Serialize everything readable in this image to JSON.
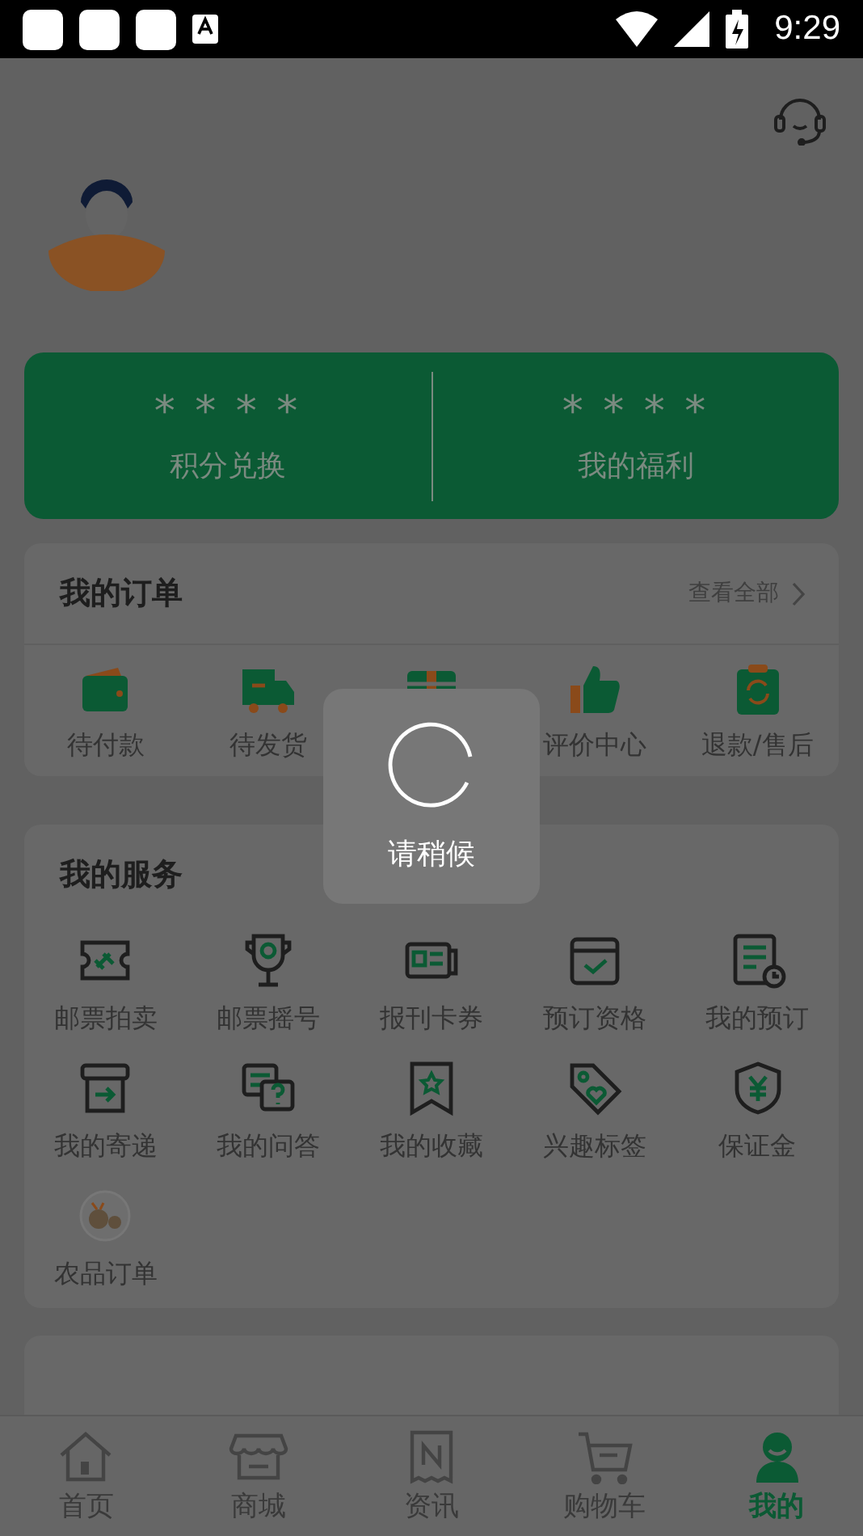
{
  "status_bar": {
    "time": "9:29"
  },
  "points": [
    {
      "value": "* * * *",
      "label": "积分兑换"
    },
    {
      "value": "* * * *",
      "label": "我的福利"
    }
  ],
  "orders": {
    "title": "我的订单",
    "link": "查看全部",
    "items": [
      {
        "kind": "wallet",
        "label": "待付款"
      },
      {
        "kind": "truck",
        "label": "待发货"
      },
      {
        "kind": "box"
      },
      {
        "kind": "thumb",
        "label": "评价中心"
      },
      {
        "kind": "refund",
        "label": "退款/售后"
      }
    ]
  },
  "services": {
    "title": "我的服务",
    "items": [
      {
        "kind": "ticket",
        "label": "邮票拍卖"
      },
      {
        "kind": "trophy",
        "label": "邮票摇号"
      },
      {
        "kind": "card",
        "label": "报刊卡券"
      },
      {
        "kind": "checkbox",
        "label": "预订资格"
      },
      {
        "kind": "doc-clock",
        "label": "我的预订"
      },
      {
        "kind": "parcel",
        "label": "我的寄递"
      },
      {
        "kind": "qa",
        "label": "我的问答"
      },
      {
        "kind": "bookmark",
        "label": "我的收藏"
      },
      {
        "kind": "tag",
        "label": "兴趣标签"
      },
      {
        "kind": "shield",
        "label": "保证金"
      },
      {
        "kind": "fruit",
        "label": "农品订单"
      }
    ]
  },
  "loading": {
    "text": "请稍候"
  },
  "tab_bar": [
    {
      "kind": "home",
      "label": "首页",
      "selected": false
    },
    {
      "kind": "shop",
      "label": "商城",
      "selected": false
    },
    {
      "kind": "news",
      "label": "资讯",
      "selected": false
    },
    {
      "kind": "cart",
      "label": "购物车",
      "selected": false
    },
    {
      "kind": "me",
      "label": "我的",
      "selected": true
    }
  ]
}
